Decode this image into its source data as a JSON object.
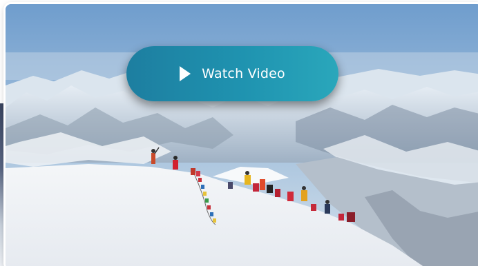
{
  "hero": {
    "image_icon": "mountain-summit-photo",
    "play_button": {
      "label": "Watch Video",
      "icon": "play-icon",
      "color": "#1f93b0"
    }
  }
}
